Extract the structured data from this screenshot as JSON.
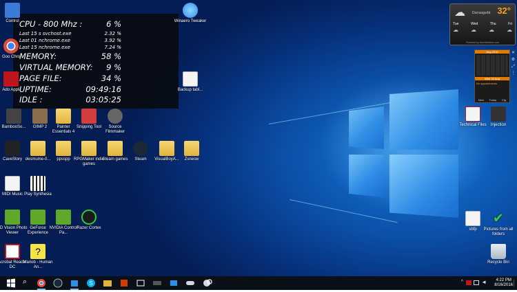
{
  "sysmon": {
    "cpu_label": "CPU - 800 Mhz :",
    "cpu_value": "6 %",
    "procs": [
      {
        "label": "Last 15 s svchost.exe",
        "value": "2.32 %"
      },
      {
        "label": "Last 01 nchrome.exe",
        "value": "3.92 %"
      },
      {
        "label": "Last 15 nchrome.exe",
        "value": "7.24 %"
      }
    ],
    "memory_label": "MEMORY:",
    "memory_value": "58 %",
    "vmem_label": "VIRTUAL MEMORY:",
    "vmem_value": "9 %",
    "page_label": "PAGE FILE:",
    "page_value": "34 %",
    "uptime_label": "UPTIME:",
    "uptime_value": "09:49:16",
    "idle_label": "IDLE :",
    "idle_value": "03:05:25"
  },
  "weather": {
    "temp": "32°",
    "location": "Durrasgurbt",
    "days": [
      "Tue",
      "Wed",
      "Thu",
      "Fri"
    ],
    "footer": "Powered by AccuWeather.com"
  },
  "calendar": {
    "month": "Aug 2016",
    "today": "Wed 10 Aug",
    "note": "No appointments",
    "tabs": [
      "New",
      "Today",
      "Cfg"
    ]
  },
  "desktop_icons": [
    {
      "label": "Control",
      "color": "#3a7bd5"
    },
    {
      "label": "Goo Chro",
      "color": "#e04a3a"
    },
    {
      "label": "Ado Appli",
      "color": "#c0161b"
    },
    {
      "label": "BambooSo...",
      "color": "#444444"
    },
    {
      "label": "GIMP 2",
      "color": "#8a6d4b"
    },
    {
      "label": "Painter Essentials 4",
      "color": "#e2b33c"
    },
    {
      "label": "Snipping Tool",
      "color": "#d43d3d"
    },
    {
      "label": "Source Filmmaker",
      "color": "#666666"
    },
    {
      "label": "CaveStory",
      "color": "#222222"
    },
    {
      "label": "desmume-0...",
      "color": "#e2b33c"
    },
    {
      "label": "ppsspp",
      "color": "#e2b33c"
    },
    {
      "label": "RPGMaker indie games",
      "color": "#e2b33c"
    },
    {
      "label": "Steam games",
      "color": "#e2b33c"
    },
    {
      "label": "Steam",
      "color": "#1b2838"
    },
    {
      "label": "VisualBoyA...",
      "color": "#e2b33c"
    },
    {
      "label": "Zsnesw",
      "color": "#e2b33c"
    },
    {
      "label": "MIDI Music",
      "color": "#e2b33c"
    },
    {
      "label": "Play Synthesia",
      "color": "#333333"
    },
    {
      "label": "3D Vision Photo Viewer",
      "color": "#5fa829"
    },
    {
      "label": "GeForce Experience",
      "color": "#5fa829"
    },
    {
      "label": "NVIDIA Control Pa...",
      "color": "#5fa829"
    },
    {
      "label": "Razer Cortex",
      "color": "#1b1b1b"
    },
    {
      "label": "Acrobat Reader DC",
      "color": "#c0161b"
    },
    {
      "label": "Mariob - Human An...",
      "color": "#f5e34a"
    },
    {
      "label": "Winaero Tweaker",
      "color": "#2f8fe8"
    },
    {
      "label": "Backup tabl...",
      "color": "#f4f4f4"
    },
    {
      "label": "Technical Files",
      "color": "#f4f4f4"
    },
    {
      "label": "Injection",
      "color": "#333333"
    },
    {
      "label": "sbfp",
      "color": "#f4f4f4"
    },
    {
      "label": "Pictures from all folders",
      "color": "#2ecc40"
    },
    {
      "label": "Recycle Bin",
      "color": "#cfd8e0"
    }
  ],
  "taskbar": {
    "apps": [
      "start-icon",
      "search-icon",
      "chrome-icon",
      "steam-icon",
      "windows-store-icon",
      "skype-icon",
      "file-explorer-icon",
      "office-icon",
      "photos-icon",
      "media-icon",
      "game-icon",
      "remote-icon",
      "paint-icon",
      "settings-icon"
    ],
    "time": "4:22 PM",
    "date": "8/16/2016"
  }
}
